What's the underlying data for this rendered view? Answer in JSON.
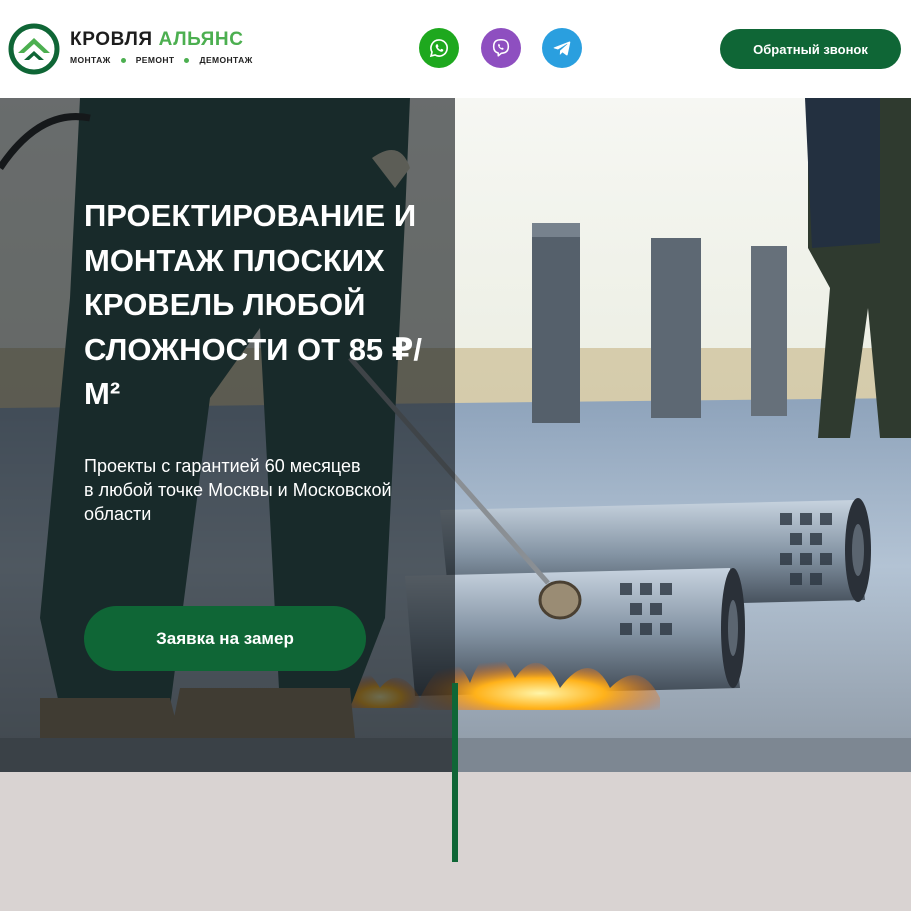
{
  "header": {
    "brand_name_part1": "КРОВЛЯ",
    "brand_name_part2": "АЛЬЯНС",
    "tagline": [
      "МОНТАЖ",
      "РЕМОНТ",
      "ДЕМОНТАЖ"
    ],
    "messengers": [
      {
        "name": "whatsapp",
        "icon": "whatsapp-icon",
        "color": "#1ea81e"
      },
      {
        "name": "viber",
        "icon": "viber-icon",
        "color": "#8e4fc0"
      },
      {
        "name": "telegram",
        "icon": "telegram-icon",
        "color": "#2a9fdf"
      }
    ],
    "callback_label": "Обратный звонок"
  },
  "hero": {
    "title": "ПРОЕКТИРОВАНИЕ И МОНТАЖ ПЛОСКИХ КРОВЕЛЬ ЛЮБОЙ СЛОЖНОСТИ ОТ 85 ₽/М²",
    "subtitle": "Проекты с гарантией 60 месяцев\nв любой точке Москвы и Московской\nобласти",
    "cta_label": "Заявка на замер"
  },
  "colors": {
    "brand_green": "#0f6636",
    "accent_green": "#4caf50",
    "lower_bg": "#d9d3d2"
  }
}
